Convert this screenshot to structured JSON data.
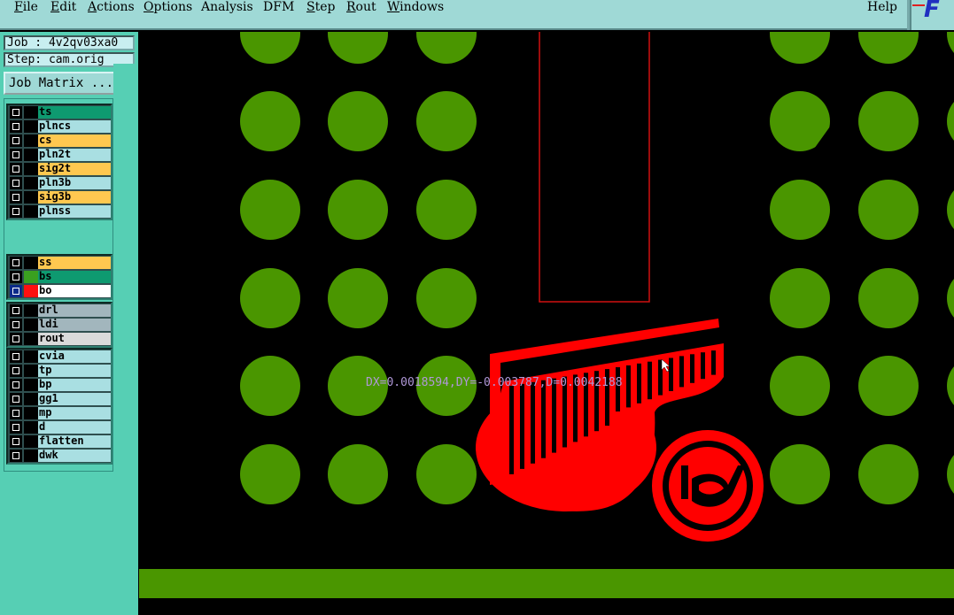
{
  "menu": {
    "items": [
      {
        "label": "File",
        "u": "F",
        "rest": "ile"
      },
      {
        "label": "Edit",
        "u": "E",
        "rest": "dit"
      },
      {
        "label": "Actions",
        "u": "A",
        "rest": "ctions"
      },
      {
        "label": "Options",
        "u": "O",
        "rest": "ptions"
      },
      {
        "label": "Analysis",
        "u": "",
        "rest": "Analysis"
      },
      {
        "label": "DFM",
        "u": "",
        "rest": "DFM"
      },
      {
        "label": "Step",
        "u": "S",
        "rest": "tep"
      },
      {
        "label": "Rout",
        "u": "R",
        "rest": "out"
      },
      {
        "label": "Windows",
        "u": "W",
        "rest": "indows"
      },
      {
        "label": "Help",
        "u": "",
        "rest": "Help"
      }
    ],
    "logo_text": "F"
  },
  "job": {
    "label": "Job : 4v2qv03xa0"
  },
  "step": {
    "label": "Step: cam.orig"
  },
  "job_matrix_label": "Job Matrix ...",
  "layers": {
    "group1": [
      {
        "name": "ts",
        "color": "#0e9a70",
        "swatch": "#000",
        "mark": ""
      },
      {
        "name": "plncs",
        "color": "#a9dfe2",
        "swatch": "#000",
        "mark": ""
      },
      {
        "name": "cs",
        "color": "#ffc850",
        "swatch": "#000",
        "mark": ""
      },
      {
        "name": "pln2t",
        "color": "#a9dfe2",
        "swatch": "#000",
        "mark": ""
      },
      {
        "name": "sig2t",
        "color": "#ffc850",
        "swatch": "#000",
        "mark": "✐"
      },
      {
        "name": "pln3b",
        "color": "#a9dfe2",
        "swatch": "#000",
        "mark": ""
      },
      {
        "name": "sig3b",
        "color": "#ffc850",
        "swatch": "#000",
        "mark": "✐"
      },
      {
        "name": "plnss",
        "color": "#a9dfe2",
        "swatch": "#000",
        "mark": ""
      }
    ],
    "group2": [
      {
        "name": "ss",
        "color": "#ffc850",
        "swatch": "#000",
        "mark": ""
      },
      {
        "name": "bs",
        "color": "#0e9a70",
        "swatch": "#3aa020",
        "mark": ""
      },
      {
        "name": "bo",
        "color": "#ffffff",
        "swatch": "#ff1010",
        "mark": "⊞"
      }
    ],
    "group3": [
      {
        "name": "drl",
        "color": "#a2b6bd",
        "swatch": "#000",
        "mark": ""
      },
      {
        "name": "ldi",
        "color": "#a2b6bd",
        "swatch": "#000",
        "mark": ""
      },
      {
        "name": "rout",
        "color": "#dadada",
        "swatch": "#000",
        "mark": ""
      }
    ],
    "group4": [
      {
        "name": "cvia",
        "color": "#a9dfe2",
        "swatch": "#000",
        "mark": ""
      },
      {
        "name": "tp",
        "color": "#a9dfe2",
        "swatch": "#000",
        "mark": ""
      },
      {
        "name": "bp",
        "color": "#a9dfe2",
        "swatch": "#000",
        "mark": ""
      },
      {
        "name": "gg1",
        "color": "#a9dfe2",
        "swatch": "#000",
        "mark": ""
      },
      {
        "name": "mp",
        "color": "#a9dfe2",
        "swatch": "#000",
        "mark": ""
      },
      {
        "name": "d",
        "color": "#a9dfe2",
        "swatch": "#000",
        "mark": ""
      },
      {
        "name": "flatten",
        "color": "#a9dfe2",
        "swatch": "#000",
        "mark": ""
      },
      {
        "name": "dwk",
        "color": "#a9dfe2",
        "swatch": "#000",
        "mark": ""
      }
    ]
  },
  "canvas": {
    "measure_text": "DX=0.0018594,DY=-0.003787,D=0.0042188",
    "pad_color": "#4a9600",
    "feature_color": "#ff0000",
    "outline_color": "#d01010",
    "background": "#000000"
  }
}
